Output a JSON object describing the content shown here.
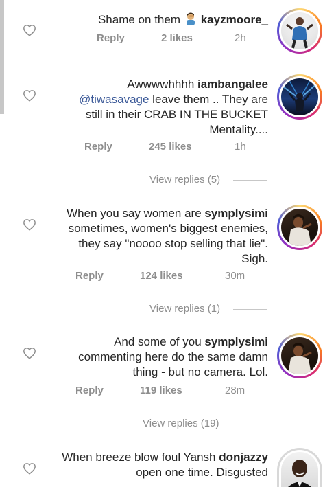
{
  "comments": [
    {
      "username": "kayzmoore_",
      "text_before": "Shame on them ",
      "emoji": "man-facepalming-emoji",
      "reply_label": "Reply",
      "likes": "2 likes",
      "time": "2h"
    },
    {
      "lead": "Awwwwhhhh ",
      "username": "iambangalee",
      "mention": "@tiwasavage",
      "line2_rest": " leave them .. They are",
      "line3": "still in their CRAB IN THE BUCKET",
      "line4": "Mentality....",
      "reply_label": "Reply",
      "likes": "245 likes",
      "time": "1h",
      "view_replies": "View replies (5)"
    },
    {
      "line1": "When you say women are ",
      "username": "symplysimi",
      "line2": "sometimes, women's biggest enemies,",
      "line3": "they say \"noooo stop selling that lie\".",
      "line4": "Sigh.",
      "reply_label": "Reply",
      "likes": "124 likes",
      "time": "30m",
      "view_replies": "View replies (1)"
    },
    {
      "line1": "And some of you ",
      "username": "symplysimi",
      "line2": "commenting here do the same damn",
      "line3": "thing - but no camera. Lol.",
      "reply_label": "Reply",
      "likes": "119 likes",
      "time": "28m",
      "view_replies": "View replies (19)"
    },
    {
      "line1": "When breeze blow foul Yansh ",
      "username": "donjazzy",
      "line2": "open one time. Disgusted"
    }
  ],
  "icons": {
    "like": "heart-outline-icon"
  },
  "colors": {
    "text": "#262626",
    "meta": "#8e8e8e",
    "mention": "#3b5998"
  }
}
